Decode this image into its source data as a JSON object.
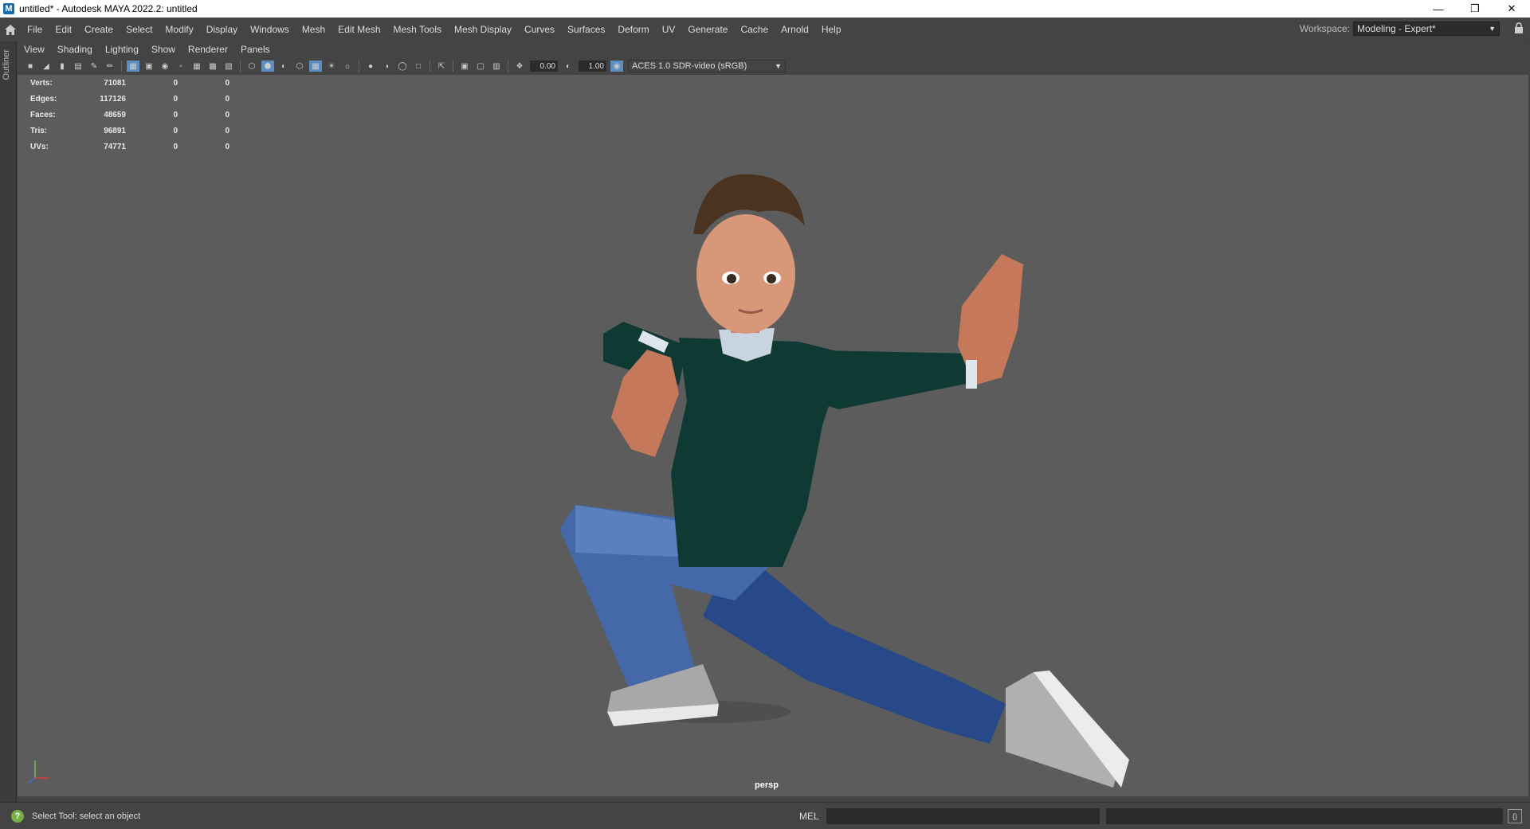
{
  "window": {
    "title": "untitled* - Autodesk MAYA 2022.2: untitled",
    "logo": "M"
  },
  "menu": [
    "File",
    "Edit",
    "Create",
    "Select",
    "Modify",
    "Display",
    "Windows",
    "Mesh",
    "Edit Mesh",
    "Mesh Tools",
    "Mesh Display",
    "Curves",
    "Surfaces",
    "Deform",
    "UV",
    "Generate",
    "Cache",
    "Arnold",
    "Help"
  ],
  "workspace": {
    "label": "Workspace:",
    "value": "Modeling - Expert*"
  },
  "outliner": "Outliner",
  "panel_menu": [
    "View",
    "Shading",
    "Lighting",
    "Show",
    "Renderer",
    "Panels"
  ],
  "toolbar": {
    "val1": "0.00",
    "val2": "1.00",
    "colorspace": "ACES 1.0 SDR-video (sRGB)"
  },
  "hud": [
    {
      "label": "Verts:",
      "value": "71081",
      "c1": "0",
      "c2": "0"
    },
    {
      "label": "Edges:",
      "value": "117126",
      "c1": "0",
      "c2": "0"
    },
    {
      "label": "Faces:",
      "value": "48659",
      "c1": "0",
      "c2": "0"
    },
    {
      "label": "Tris:",
      "value": "96891",
      "c1": "0",
      "c2": "0"
    },
    {
      "label": "UVs:",
      "value": "74771",
      "c1": "0",
      "c2": "0"
    }
  ],
  "camera": "persp",
  "status": {
    "message": "Select Tool: select an object",
    "mel": "MEL"
  }
}
